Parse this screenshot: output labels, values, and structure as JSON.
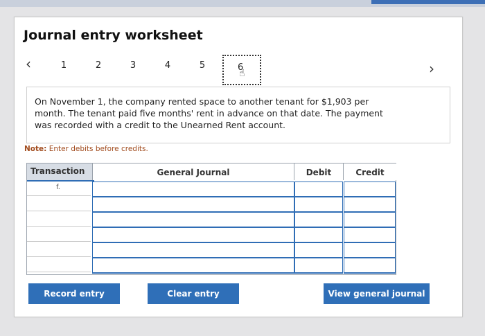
{
  "header": {
    "title": "Journal entry worksheet"
  },
  "nav": {
    "steps": [
      "1",
      "2",
      "3",
      "4",
      "5"
    ],
    "active_step": "6"
  },
  "prompt": {
    "text": "On November 1, the company rented space to another tenant for $1,903 per month. The tenant paid five months' rent in advance on that date. The payment was recorded with a credit to the Unearned Rent account."
  },
  "note": {
    "label": "Note:",
    "text": "Enter debits before credits."
  },
  "table": {
    "headers": {
      "transaction": "Transaction",
      "general_journal": "General Journal",
      "debit": "Debit",
      "credit": "Credit"
    },
    "rows": [
      {
        "transaction": "f.",
        "account": "",
        "debit": "",
        "credit": ""
      },
      {
        "transaction": "",
        "account": "",
        "debit": "",
        "credit": ""
      },
      {
        "transaction": "",
        "account": "",
        "debit": "",
        "credit": ""
      },
      {
        "transaction": "",
        "account": "",
        "debit": "",
        "credit": ""
      },
      {
        "transaction": "",
        "account": "",
        "debit": "",
        "credit": ""
      },
      {
        "transaction": "",
        "account": "",
        "debit": "",
        "credit": ""
      }
    ]
  },
  "buttons": {
    "record": "Record entry",
    "clear": "Clear entry",
    "view": "View general journal"
  },
  "colors": {
    "accent": "#2f6fb8",
    "note": "#a14b1d"
  },
  "icons": {
    "prev": "chevron-left-icon",
    "next": "chevron-right-icon",
    "cursor": "hand-pointer-icon"
  }
}
